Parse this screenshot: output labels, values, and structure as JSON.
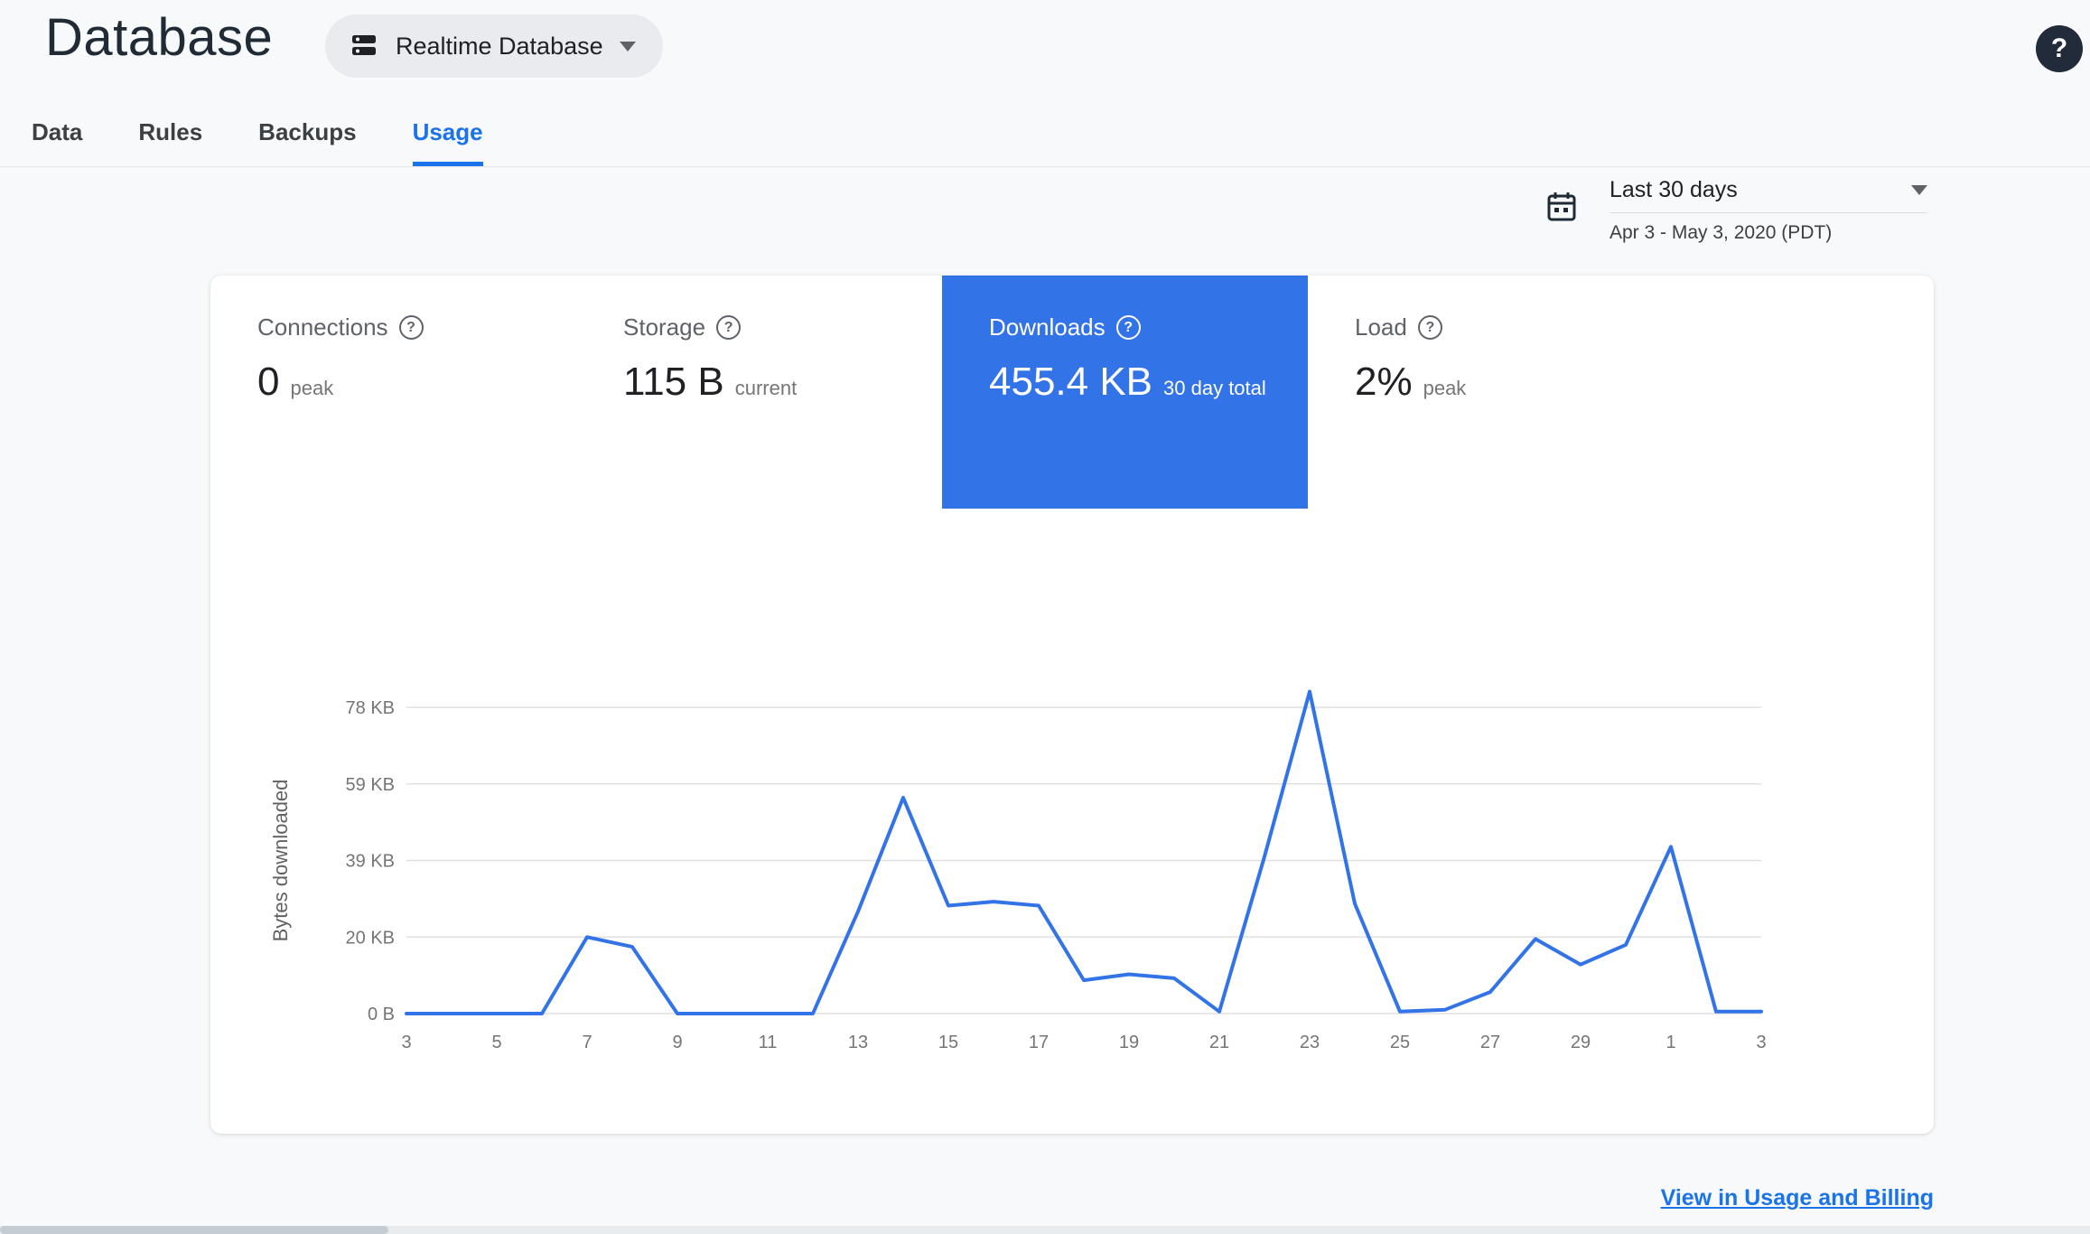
{
  "colors": {
    "accent": "#1a73e8",
    "tile_selected_bg": "#3373e8",
    "chart_line": "#3373e8",
    "page_bg": "#f8f9fa"
  },
  "header": {
    "title": "Database",
    "database_selector": {
      "label": "Realtime Database"
    },
    "help_label": "?"
  },
  "tabs": [
    {
      "label": "Data",
      "active": false
    },
    {
      "label": "Rules",
      "active": false
    },
    {
      "label": "Backups",
      "active": false
    },
    {
      "label": "Usage",
      "active": true
    }
  ],
  "date_range": {
    "preset": "Last 30 days",
    "range": "Apr 3 - May 3, 2020 (PDT)"
  },
  "metrics": [
    {
      "title": "Connections",
      "value": "0",
      "unit_label": "peak",
      "selected": false
    },
    {
      "title": "Storage",
      "value": "115 B",
      "unit_label": "current",
      "selected": false
    },
    {
      "title": "Downloads",
      "value": "455.4 KB",
      "unit_label": "30 day total",
      "selected": true
    },
    {
      "title": "Load",
      "value": "2%",
      "unit_label": "peak",
      "selected": false
    }
  ],
  "chart_data": {
    "type": "line",
    "ylabel": "Bytes downloaded",
    "x": [
      "3",
      "4",
      "5",
      "6",
      "7",
      "8",
      "9",
      "10",
      "11",
      "12",
      "13",
      "14",
      "15",
      "16",
      "17",
      "18",
      "19",
      "20",
      "21",
      "22",
      "23",
      "24",
      "25",
      "26",
      "27",
      "28",
      "29",
      "30",
      "1",
      "2",
      "3"
    ],
    "x_tick_step": 2,
    "values_kb": [
      0,
      0,
      0,
      0,
      19.5,
      17,
      0,
      0,
      0,
      0,
      26,
      55,
      27.5,
      28.5,
      27.5,
      8.5,
      10,
      9,
      0.5,
      40,
      82,
      28,
      0.5,
      1,
      5.5,
      19,
      12.5,
      17.5,
      42.5,
      0.5,
      0.5
    ],
    "y_ticks": [
      {
        "value": 0,
        "label": "0 B"
      },
      {
        "value": 19.5,
        "label": "20 KB"
      },
      {
        "value": 39,
        "label": "39 KB"
      },
      {
        "value": 58.5,
        "label": "59 KB"
      },
      {
        "value": 78,
        "label": "78 KB"
      }
    ],
    "ylim": [
      0,
      85
    ],
    "grid": true,
    "legend": "none"
  },
  "footer": {
    "usage_billing_link": "View in Usage and Billing"
  }
}
